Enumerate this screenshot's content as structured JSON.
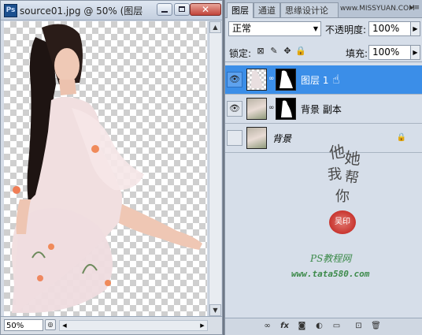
{
  "document": {
    "title": "source01.jpg @ 50% (图层",
    "app_icon": "Ps",
    "zoom": "50%"
  },
  "layers_panel": {
    "tabs": [
      {
        "label": "图层",
        "active": true
      },
      {
        "label": "通道",
        "active": false
      },
      {
        "label": "思缘设计论坛",
        "active": false
      }
    ],
    "tab_overlay_text": "www.MISSYUAN.COM",
    "blend_mode": "正常",
    "opacity_label": "不透明度:",
    "opacity_value": "100%",
    "lock_label": "锁定:",
    "fill_label": "填充:",
    "fill_value": "100%",
    "layers": [
      {
        "name": "图层 1",
        "selected": true,
        "visible": true,
        "has_mask": true
      },
      {
        "name": "背景 副本",
        "selected": false,
        "visible": true,
        "has_mask": true
      },
      {
        "name": "背景",
        "selected": false,
        "visible": false,
        "has_mask": false,
        "locked": true
      }
    ]
  },
  "watermark": {
    "calligraphy": [
      "他",
      "她",
      "我",
      "帮",
      "你"
    ],
    "seal": "吴印",
    "site_name": "PS教程网",
    "url": "www.tata580.com"
  },
  "colors": {
    "selection": "#3b8ee8",
    "panel_bg": "#d6dee9",
    "watermark_green": "#3c8a4a",
    "seal_red": "#c8352f"
  }
}
